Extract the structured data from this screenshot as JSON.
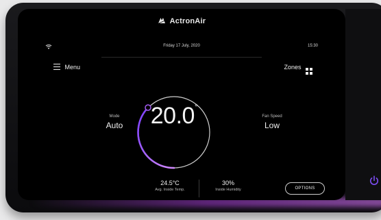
{
  "brand": {
    "name": "ActronAir"
  },
  "status": {
    "date": "Friday 17 July, 2020",
    "time": "15:30"
  },
  "nav": {
    "menu_label": "Menu",
    "zones_label": "Zones"
  },
  "mode": {
    "label": "Mode",
    "value": "Auto"
  },
  "fan": {
    "label": "Fan Speed",
    "value": "Low"
  },
  "setpoint": {
    "value": "20.0",
    "unit_symbol": "°"
  },
  "stats": {
    "inside_temp": {
      "value": "24.5°C",
      "label": "Avg. Inside Temp."
    },
    "inside_humidity": {
      "value": "30%",
      "label": "Inside Humidity"
    }
  },
  "buttons": {
    "options": "OPTIONS"
  },
  "colors": {
    "accent_purple": "#a35cf2",
    "accent_pink": "#d38bff"
  },
  "icons": {
    "wifi": "wifi-icon",
    "menu": "hamburger-icon",
    "zones": "grid-icon",
    "power": "power-icon"
  }
}
